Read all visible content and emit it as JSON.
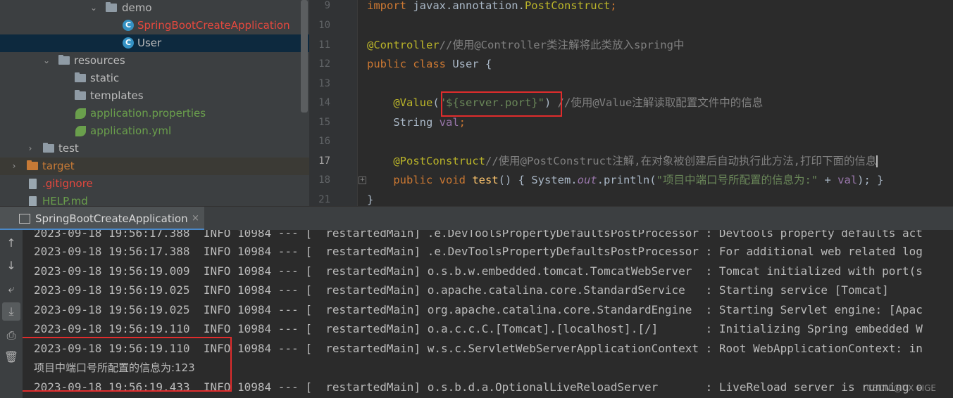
{
  "project_tree": {
    "items": [
      {
        "label": "demo",
        "type": "package",
        "color": "#bbbbbb"
      },
      {
        "label": "SpringBootCreateApplication",
        "type": "class",
        "color": "#e5483e"
      },
      {
        "label": "User",
        "type": "class",
        "color": "#bbbbbb",
        "selected": true
      },
      {
        "label": "resources",
        "type": "folder",
        "color": "#bbbbbb"
      },
      {
        "label": "static",
        "type": "folder",
        "color": "#bbbbbb"
      },
      {
        "label": "templates",
        "type": "folder",
        "color": "#bbbbbb"
      },
      {
        "label": "application.properties",
        "type": "spring-config",
        "color": "#6a9f4c"
      },
      {
        "label": "application.yml",
        "type": "spring-config",
        "color": "#6a9f4c"
      },
      {
        "label": "test",
        "type": "folder",
        "color": "#bbbbbb"
      },
      {
        "label": "target",
        "type": "folder-excluded",
        "color": "#c77a36"
      },
      {
        "label": ".gitignore",
        "type": "file",
        "color": "#e5483e"
      },
      {
        "label": "HELP.md",
        "type": "file",
        "color": "#6a9f4c"
      }
    ]
  },
  "editor": {
    "line_numbers": [
      "9",
      "10",
      "11",
      "12",
      "13",
      "14",
      "15",
      "16",
      "17",
      "18",
      "21"
    ],
    "current_line": "17",
    "lines": [
      [
        {
          "t": "import ",
          "c": "kw"
        },
        {
          "t": "javax.annotation.",
          "c": ""
        },
        {
          "t": "PostConstruct",
          "c": "an"
        },
        {
          "t": ";",
          "c": "kw"
        }
      ],
      [],
      [
        {
          "t": "@Controller",
          "c": "an"
        },
        {
          "t": "//使用@Controller类注解将此类放入spring中",
          "c": "cm"
        }
      ],
      [
        {
          "t": "public ",
          "c": "kw"
        },
        {
          "t": "class ",
          "c": "kw"
        },
        {
          "t": "User ",
          "c": "cls-name"
        },
        {
          "t": "{",
          "c": ""
        }
      ],
      [],
      [
        {
          "t": "    @Value",
          "c": "an"
        },
        {
          "t": "(",
          "c": ""
        },
        {
          "t": "\"${server.port}\"",
          "c": "st"
        },
        {
          "t": ") ",
          "c": ""
        },
        {
          "t": "//使用@Value注解读取配置文件中的信息",
          "c": "cm"
        }
      ],
      [
        {
          "t": "    String ",
          "c": ""
        },
        {
          "t": "val",
          "c": "fld"
        },
        {
          "t": ";",
          "c": "kw"
        }
      ],
      [],
      [
        {
          "t": "    @PostConstruct",
          "c": "an"
        },
        {
          "t": "//使用@PostConstruct注解,在对象被创建后自动执行此方法,打印下面的信息",
          "c": "cm"
        }
      ],
      [
        {
          "t": "    public ",
          "c": "kw"
        },
        {
          "t": "void ",
          "c": "kw"
        },
        {
          "t": "test",
          "c": "mth"
        },
        {
          "t": "() { System.",
          "c": ""
        },
        {
          "t": "out",
          "c": "static-f"
        },
        {
          "t": ".println(",
          "c": ""
        },
        {
          "t": "\"项目中端口号所配置的信息为:\" ",
          "c": "st"
        },
        {
          "t": "+ ",
          "c": ""
        },
        {
          "t": "val",
          "c": "fld"
        },
        {
          "t": "); }",
          "c": ""
        }
      ],
      [
        {
          "t": "}",
          "c": ""
        }
      ]
    ]
  },
  "run_panel": {
    "tab_label": "SpringBootCreateApplication",
    "close_glyph": "×"
  },
  "console": {
    "lines": [
      "2023-09-18 19:56:17.388  INFO 10984 --- [  restartedMain] .e.DevToolsPropertyDefaultsPostProcessor : Devtools property defaults act",
      "2023-09-18 19:56:17.388  INFO 10984 --- [  restartedMain] .e.DevToolsPropertyDefaultsPostProcessor : For additional web related log",
      "2023-09-18 19:56:19.009  INFO 10984 --- [  restartedMain] o.s.b.w.embedded.tomcat.TomcatWebServer  : Tomcat initialized with port(s",
      "2023-09-18 19:56:19.025  INFO 10984 --- [  restartedMain] o.apache.catalina.core.StandardService   : Starting service [Tomcat]",
      "2023-09-18 19:56:19.025  INFO 10984 --- [  restartedMain] org.apache.catalina.core.StandardEngine  : Starting Servlet engine: [Apac",
      "2023-09-18 19:56:19.110  INFO 10984 --- [  restartedMain] o.a.c.c.C.[Tomcat].[localhost].[/]       : Initializing Spring embedded W",
      "2023-09-18 19:56:19.110  INFO 10984 --- [  restartedMain] w.s.c.ServletWebServerApplicationContext : Root WebApplicationContext: in",
      "项目中端口号所配置的信息为:123",
      "2023-09-18 19:56:19.433  INFO 10984 --- [  restartedMain] o.s.b.d.a.OptionalLiveReloadServer       : LiveReload server is running o"
    ]
  },
  "toolbar_icons": [
    "arrow-up-icon",
    "arrow-down-icon",
    "soft-wrap-icon",
    "scroll-to-end-icon",
    "print-icon",
    "trash-icon"
  ],
  "watermark": "CSDN @UX PIGE",
  "colors": {
    "highlight": "#e02c2c",
    "selection": "#0d293e",
    "accent": "#4a88c7"
  }
}
